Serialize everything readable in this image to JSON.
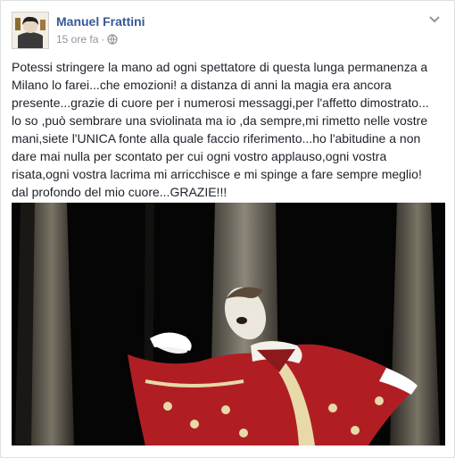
{
  "post": {
    "author": "Manuel Frattini",
    "timestamp": "15 ore fa",
    "separator": "·",
    "privacy_icon": "globe-icon",
    "menu_icon": "chevron-down-icon",
    "lines": [
      "Potessi stringere la mano ad ogni spettatore di questa lunga permanenza a",
      "Milano lo farei...che emozioni! a distanza di anni la magia era ancora",
      "presente...grazie di cuore per i numerosi messaggi,per l'affetto dimostrato...",
      "lo so ,può sembrare una sviolinata ma io ,da sempre,mi rimetto nelle vostre",
      "mani,siete l'UNICA fonte alla quale faccio riferimento...ho l'abitudine a non",
      "dare mai nulla per scontato per cui ogni vostro applauso,ogni vostra",
      "risata,ogni vostra lacrima mi arricchisce e mi spinge a fare sempre meglio!",
      "dal profondo del mio cuore...GRAZIE!!!"
    ]
  },
  "colors": {
    "author_link": "#365899",
    "meta_text": "#90949c",
    "body_text": "#1d2129",
    "costume_red": "#b01e24"
  }
}
